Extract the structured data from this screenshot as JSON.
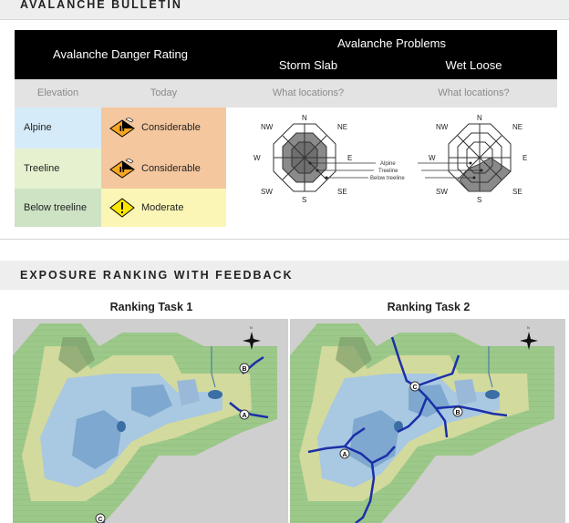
{
  "bulletin": {
    "title": "AVALANCHE BULLETIN",
    "table": {
      "danger_rating_header": "Avalanche Danger Rating",
      "problems_header": "Avalanche Problems",
      "problems": [
        "Storm Slab",
        "Wet Loose"
      ],
      "subheader": {
        "elevation": "Elevation",
        "today": "Today",
        "locations_1": "What locations?",
        "locations_2": "What locations?"
      },
      "rows": [
        {
          "elevation": "Alpine",
          "rating": "Considerable",
          "color": "#d6ebf9",
          "rating_color": "#f5c79e"
        },
        {
          "elevation": "Treeline",
          "rating": "Considerable",
          "color": "#e6f2cf",
          "rating_color": "#f5c79e"
        },
        {
          "elevation": "Below treeline",
          "rating": "Moderate",
          "color": "#cde3c4",
          "rating_color": "#fbf6b5"
        }
      ]
    },
    "rose": {
      "directions": [
        "N",
        "NE",
        "E",
        "SE",
        "S",
        "SW",
        "W",
        "NW"
      ],
      "legend": [
        "Alpine",
        "Treeline",
        "Below treeline"
      ]
    }
  },
  "exposure": {
    "title": "EXPOSURE RANKING WITH FEEDBACK",
    "tasks": [
      {
        "title": "Ranking Task 1",
        "markers": [
          "B",
          "A",
          "C"
        ]
      },
      {
        "title": "Ranking Task 2",
        "markers": [
          "C",
          "B",
          "A"
        ]
      }
    ],
    "north_label": "N"
  },
  "colors": {
    "header_black": "#000000",
    "considerable": "#f5a623",
    "moderate": "#ffe600",
    "route_blue": "#1b2fa8"
  }
}
